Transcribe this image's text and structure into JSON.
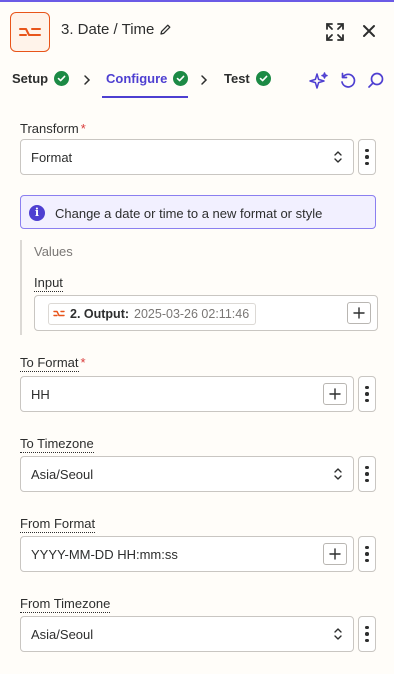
{
  "header": {
    "title": "3. Date / Time"
  },
  "tabs": [
    {
      "label": "Setup",
      "status": "complete"
    },
    {
      "label": "Configure",
      "status": "complete",
      "active": true
    },
    {
      "label": "Test",
      "status": "complete"
    }
  ],
  "colors": {
    "accent": "#4e3fd1",
    "brand_orange": "#e8541a",
    "success": "#1c8a45",
    "required": "#d93a3a"
  },
  "form": {
    "transform": {
      "label": "Transform",
      "required": true,
      "value": "Format"
    },
    "info_text": "Change a date or time to a new format or style",
    "values": {
      "title": "Values",
      "input_label": "Input",
      "input_step": "2. Output:",
      "input_value": "2025-03-26 02:11:46"
    },
    "to_format": {
      "label": "To Format",
      "required": true,
      "value": "HH"
    },
    "to_timezone": {
      "label": "To Timezone",
      "value": "Asia/Seoul"
    },
    "from_format": {
      "label": "From Format",
      "value": "YYYY-MM-DD HH:mm:ss"
    },
    "from_timezone": {
      "label": "From Timezone",
      "value": "Asia/Seoul"
    }
  },
  "icons": {
    "app": "date-time-icon",
    "edit": "pencil-icon",
    "expand": "expand-icon",
    "close": "close-icon",
    "ai": "sparkle-icon",
    "undo": "undo-icon",
    "search": "search-icon"
  }
}
